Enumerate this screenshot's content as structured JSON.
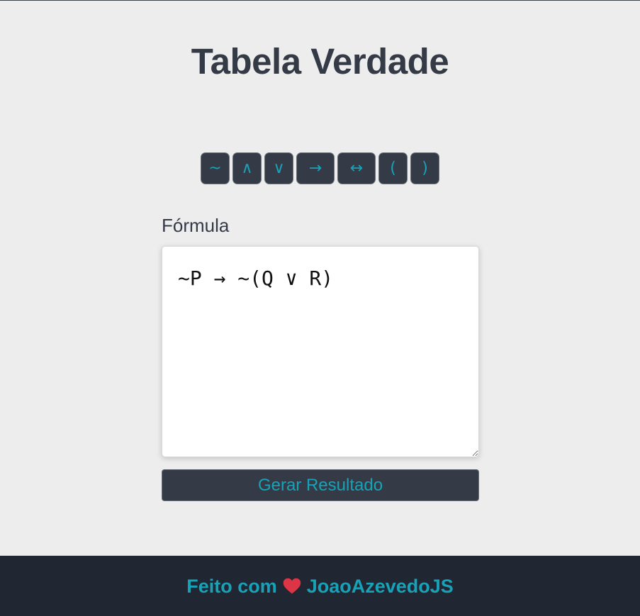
{
  "header": {
    "title": "Tabela Verdade"
  },
  "toolbar": {
    "symbols": [
      {
        "label": "~",
        "name": "not-symbol-button"
      },
      {
        "label": "∧",
        "name": "and-symbol-button"
      },
      {
        "label": "∨",
        "name": "or-symbol-button"
      },
      {
        "label": "→",
        "name": "implies-symbol-button"
      },
      {
        "label": "↔",
        "name": "biconditional-symbol-button"
      },
      {
        "label": "(",
        "name": "open-paren-button"
      },
      {
        "label": ")",
        "name": "close-paren-button"
      }
    ]
  },
  "form": {
    "label": "Fórmula",
    "formula_value": "~P → ~(Q ∨ R)",
    "submit_label": "Gerar Resultado"
  },
  "footer": {
    "text_before": "Feito com",
    "icon": "heart-icon",
    "author": "JoaoAzevedoJS"
  },
  "colors": {
    "background": "#ededed",
    "dark": "#353b46",
    "accent": "#17a2b8",
    "footer_bg": "#212732",
    "heart": "#dc3545"
  }
}
